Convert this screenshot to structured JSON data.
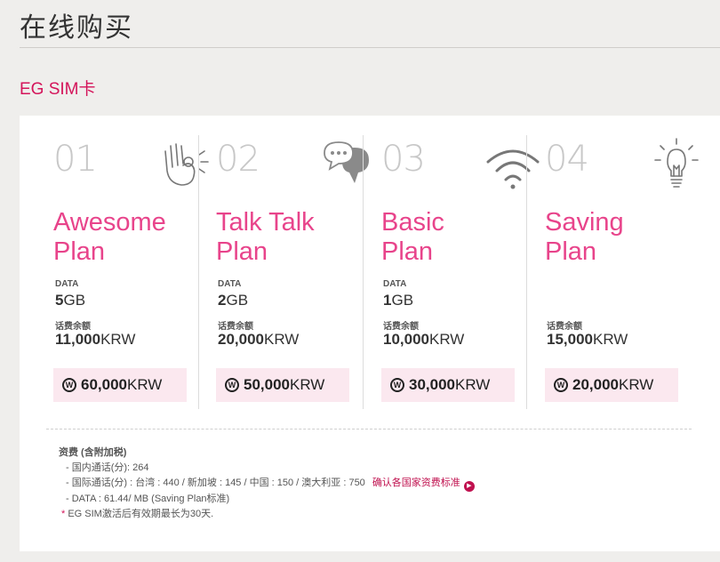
{
  "page": {
    "title": "在线购买",
    "section_title": "EG SIM卡"
  },
  "plans": [
    {
      "number": "01",
      "name_line1": "Awesome",
      "name_line2": "Plan",
      "icon": "ok-hand-icon",
      "data_label": "DATA",
      "data_num": "5",
      "data_unit": "GB",
      "balance_label": "话费余额",
      "balance_num": "11,000",
      "balance_unit": "KRW",
      "price_num": "60,000",
      "price_unit": "KRW"
    },
    {
      "number": "02",
      "name_line1": "Talk Talk",
      "name_line2": "Plan",
      "icon": "chat-bubbles-icon",
      "data_label": "DATA",
      "data_num": "2",
      "data_unit": "GB",
      "balance_label": "话费余额",
      "balance_num": "20,000",
      "balance_unit": "KRW",
      "price_num": "50,000",
      "price_unit": "KRW"
    },
    {
      "number": "03",
      "name_line1": "Basic",
      "name_line2": "Plan",
      "icon": "wifi-icon",
      "data_label": "DATA",
      "data_num": "1",
      "data_unit": "GB",
      "balance_label": "话费余额",
      "balance_num": "10,000",
      "balance_unit": "KRW",
      "price_num": "30,000",
      "price_unit": "KRW"
    },
    {
      "number": "04",
      "name_line1": "Saving",
      "name_line2": "Plan",
      "icon": "light-bulb-icon",
      "balance_label": "话费余额",
      "balance_num": "15,000",
      "balance_unit": "KRW",
      "price_num": "20,000",
      "price_unit": "KRW"
    }
  ],
  "currency_symbol": "W",
  "notes": {
    "fee_title": "资费 (含附加税)",
    "domestic": "- 国内通话(分): 264",
    "international": "- 国际通话(分) : 台湾 : 440 / 新加坡 : 145 / 中国 : 150 / 澳大利亚 : 750",
    "rates_link": "确认各国家资费标准",
    "data_rate": "- DATA : 61.44/ MB (Saving Plan标准)",
    "validity_mark": "*",
    "validity": " EG SIM激活后有效期最长为30天."
  },
  "colors": {
    "accent": "#d4145a",
    "plan_name": "#e8448b",
    "price_bg": "#fbe8ef",
    "page_bg": "#efeeec"
  }
}
